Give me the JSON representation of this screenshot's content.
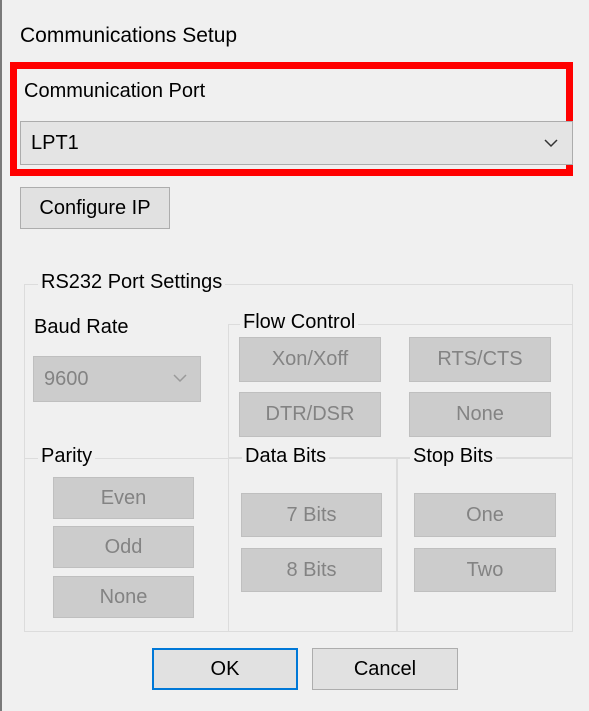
{
  "window": {
    "title": "Communications Setup"
  },
  "port": {
    "label": "Communication Port",
    "selected": "LPT1"
  },
  "configure_ip_label": "Configure IP",
  "rs232": {
    "group_label": "RS232 Port Settings",
    "baud": {
      "label": "Baud Rate",
      "selected": "9600"
    },
    "flow": {
      "label": "Flow Control",
      "xon_xoff": "Xon/Xoff",
      "rts_cts": "RTS/CTS",
      "dtr_dsr": "DTR/DSR",
      "none": "None"
    },
    "parity": {
      "label": "Parity",
      "even": "Even",
      "odd": "Odd",
      "none": "None"
    },
    "data_bits": {
      "label": "Data Bits",
      "seven": "7 Bits",
      "eight": "8 Bits"
    },
    "stop_bits": {
      "label": "Stop Bits",
      "one": "One",
      "two": "Two"
    }
  },
  "dialog_buttons": {
    "ok": "OK",
    "cancel": "Cancel"
  },
  "colors": {
    "highlight": "#ff0000",
    "focus_border": "#0078d7",
    "disabled_text": "#838383"
  }
}
